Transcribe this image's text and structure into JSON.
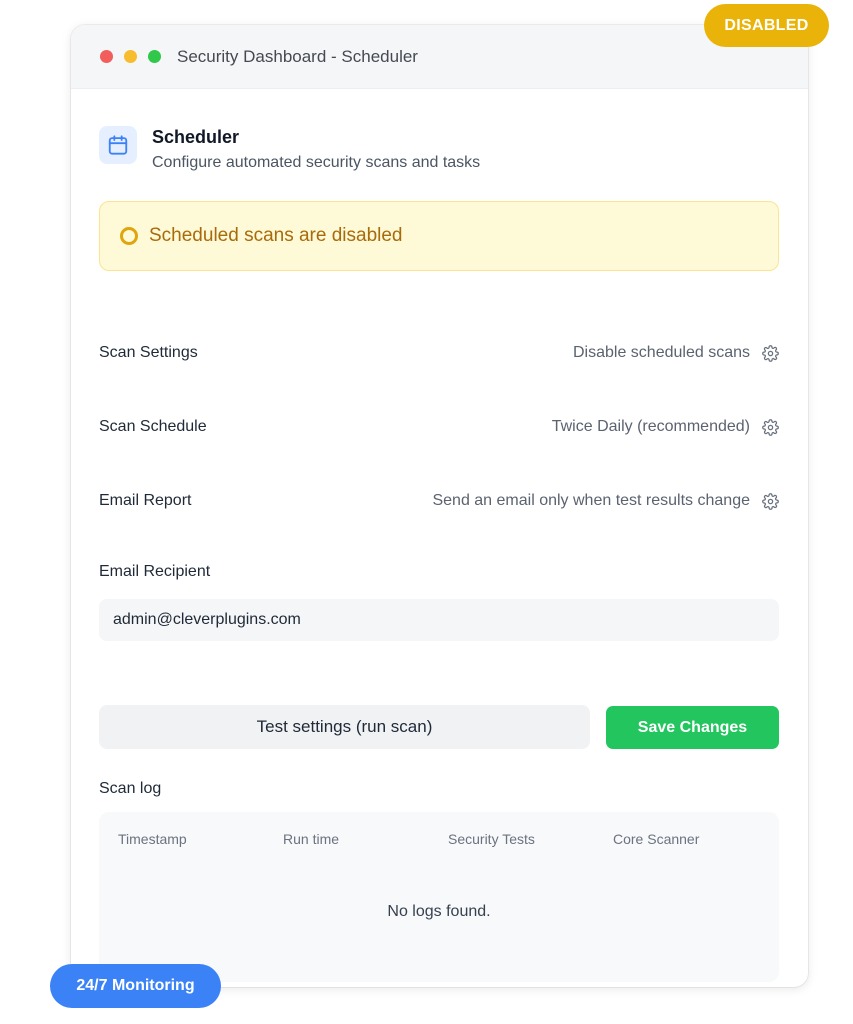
{
  "window": {
    "title": "Security Dashboard - Scheduler"
  },
  "header": {
    "title": "Scheduler",
    "subtitle": "Configure automated security scans and tasks",
    "icon": "calendar-icon"
  },
  "alert": {
    "text": "Scheduled scans are disabled",
    "color": "#a86b0b"
  },
  "settings": [
    {
      "label": "Scan Settings",
      "value": "Disable scheduled scans"
    },
    {
      "label": "Scan Schedule",
      "value": "Twice Daily (recommended)"
    },
    {
      "label": "Email Report",
      "value": "Send an email only when test results change"
    }
  ],
  "email_recipient": {
    "label": "Email Recipient",
    "value": "admin@cleverplugins.com"
  },
  "actions": {
    "test_label": "Test settings (run scan)",
    "save_label": "Save Changes",
    "save_color": "#22c55e"
  },
  "scan_log": {
    "title": "Scan log",
    "columns": [
      "Timestamp",
      "Run time",
      "Security Tests",
      "Core Scanner"
    ],
    "empty_text": "No logs found."
  },
  "badges": {
    "status": "DISABLED",
    "status_color": "#eab30a",
    "monitoring": "24/7 Monitoring",
    "monitoring_color": "#3b82f6"
  }
}
